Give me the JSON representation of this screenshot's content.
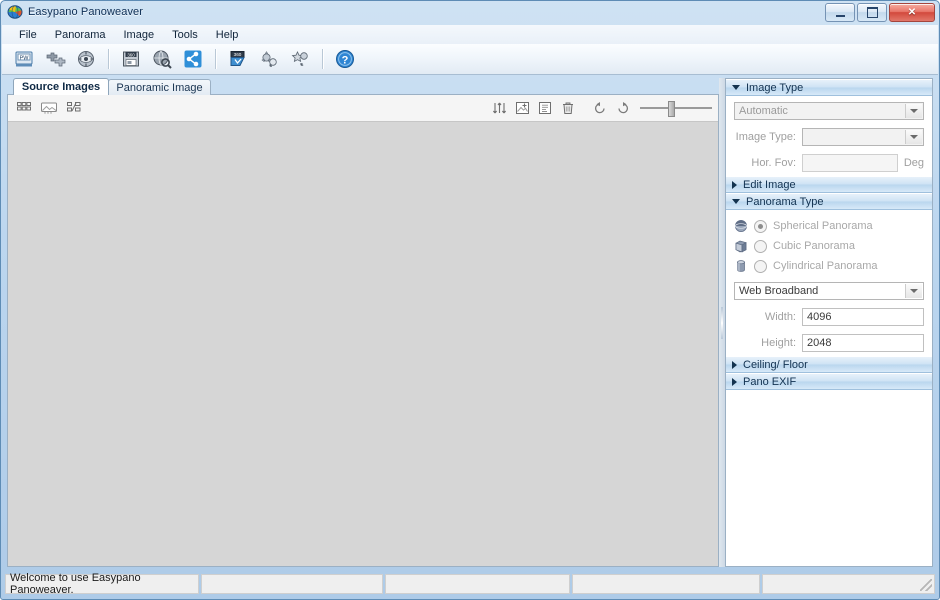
{
  "window": {
    "title": "Easypano Panoweaver",
    "icon": "panorama-globe-icon",
    "minimize_label": "Minimize",
    "maximize_label": "Maximize",
    "close_label": "Close"
  },
  "menubar": {
    "items": [
      {
        "label": "File"
      },
      {
        "label": "Panorama"
      },
      {
        "label": "Image"
      },
      {
        "label": "Tools"
      },
      {
        "label": "Help"
      }
    ]
  },
  "toolbar": {
    "buttons": [
      {
        "name": "new-project-icon",
        "title": "New Project"
      },
      {
        "name": "stitch-images-icon",
        "title": "Stitch"
      },
      {
        "name": "preview-panorama-icon",
        "title": "Preview"
      },
      {
        "name": "save-360-icon",
        "title": "Save Panorama"
      },
      {
        "name": "publish-globe-icon",
        "title": "Publish"
      },
      {
        "name": "share-icon",
        "title": "Share"
      },
      {
        "name": "batch-stitch-icon",
        "title": "Batch Stitch"
      },
      {
        "name": "hotspot-link-icon",
        "title": "Hotspot"
      },
      {
        "name": "virtual-tour-icon",
        "title": "Virtual Tour"
      },
      {
        "name": "help-icon",
        "title": "Help"
      }
    ]
  },
  "tabs": [
    {
      "label": "Source Images",
      "active": true
    },
    {
      "label": "Panoramic Image",
      "active": false
    }
  ],
  "image_toolbar": {
    "left_buttons": [
      {
        "name": "thumbnail-grid-icon",
        "title": "Thumbnail View"
      },
      {
        "name": "single-image-icon",
        "title": "Single View"
      },
      {
        "name": "list-detail-icon",
        "title": "List View"
      }
    ],
    "right_buttons": [
      {
        "name": "sort-icon",
        "title": "Sort"
      },
      {
        "name": "add-image-icon",
        "title": "Add Image"
      },
      {
        "name": "image-properties-icon",
        "title": "Properties"
      },
      {
        "name": "delete-icon",
        "title": "Delete"
      },
      {
        "name": "rotate-left-icon",
        "title": "Rotate Left"
      },
      {
        "name": "rotate-right-icon",
        "title": "Rotate Right"
      }
    ],
    "zoom_slider": {
      "name": "zoom-slider",
      "value": 40
    }
  },
  "right_panel": {
    "sections": [
      {
        "id": "image-type",
        "title": "Image Type",
        "expanded": true,
        "mode_combo": {
          "value": "Automatic",
          "enabled": false
        },
        "image_type_label": "Image Type:",
        "image_type_combo": {
          "value": "",
          "enabled": false
        },
        "hor_fov_label": "Hor. Fov:",
        "hor_fov_value": "",
        "hor_fov_unit": "Deg"
      },
      {
        "id": "edit-image",
        "title": "Edit Image",
        "expanded": false
      },
      {
        "id": "panorama-type",
        "title": "Panorama Type",
        "expanded": true,
        "options": [
          {
            "label": "Spherical Panorama",
            "selected": true,
            "icon": "sphere-icon"
          },
          {
            "label": "Cubic Panorama",
            "selected": false,
            "icon": "cube-icon"
          },
          {
            "label": "Cylindrical Panorama",
            "selected": false,
            "icon": "cylinder-icon"
          }
        ],
        "quality_combo": {
          "value": "Web Broadband",
          "enabled": true
        },
        "width_label": "Width:",
        "width_value": "4096",
        "height_label": "Height:",
        "height_value": "2048"
      },
      {
        "id": "ceiling-floor",
        "title": "Ceiling/ Floor",
        "expanded": false
      },
      {
        "id": "pano-exif",
        "title": "Pano EXIF",
        "expanded": false
      }
    ]
  },
  "statusbar": {
    "cells": [
      "Welcome to use Easypano Panoweaver.",
      "",
      "",
      "",
      ""
    ],
    "resize_grip": "resize-grip-icon"
  },
  "colors": {
    "window_frame": "#aecbe8",
    "accent_header": "#b9d6ee",
    "canvas": "#d6d6d6",
    "close_button": "#d2493c"
  }
}
